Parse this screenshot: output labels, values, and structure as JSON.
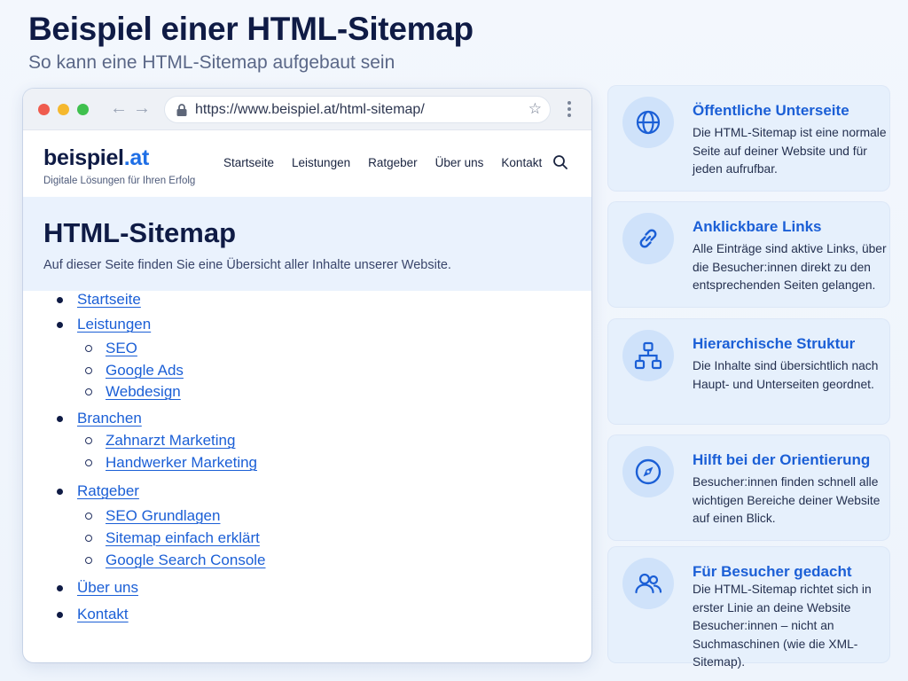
{
  "header": {
    "title": "Beispiel einer HTML-Sitemap",
    "subtitle": "So kann eine HTML-Sitemap aufgebaut sein"
  },
  "browser": {
    "url": "https://www.beispiel.at/html-sitemap/",
    "icons": [
      "back-arrow-icon",
      "forward-arrow-icon",
      "lock-icon",
      "star-icon",
      "kebab-menu-icon"
    ]
  },
  "site": {
    "logo_name": "beispiel",
    "logo_tld": ".at",
    "tagline": "Digitale Lösungen für Ihren Erfolg",
    "nav": [
      "Startseite",
      "Leistungen",
      "Ratgeber",
      "Über uns",
      "Kontakt"
    ],
    "hero_title": "HTML-Sitemap",
    "hero_description": "Auf dieser Seite finden Sie eine Übersicht aller Inhalte unserer Website."
  },
  "sitemap": [
    {
      "label": "Startseite",
      "level": 1
    },
    {
      "label": "Leistungen",
      "level": 1
    },
    {
      "label": "SEO",
      "level": 2
    },
    {
      "label": "Google Ads",
      "level": 2
    },
    {
      "label": "Webdesign",
      "level": 2
    },
    {
      "label": "Branchen",
      "level": 1
    },
    {
      "label": "Zahnarzt Marketing",
      "level": 2
    },
    {
      "label": "Handwerker Marketing",
      "level": 2
    },
    {
      "label": "Ratgeber",
      "level": 1
    },
    {
      "label": "SEO Grundlagen",
      "level": 2
    },
    {
      "label": "Sitemap einfach erklärt",
      "level": 2
    },
    {
      "label": "Google Search Console",
      "level": 2
    },
    {
      "label": "Über uns",
      "level": 1
    },
    {
      "label": "Kontakt",
      "level": 1
    }
  ],
  "cards": [
    {
      "icon": "globe-icon",
      "title": "Öffentliche Unterseite",
      "text": "Die HTML-Sitemap ist eine normale Seite auf deiner Website und für jeden aufrufbar."
    },
    {
      "icon": "link-icon",
      "title": "Anklickbare Links",
      "text": "Alle Einträge sind aktive Links, über die Besucher:innen direkt zu den entsprechenden Seiten gelangen."
    },
    {
      "icon": "hierarchy-icon",
      "title": "Hierarchische Struktur",
      "text": "Die Inhalte sind übersichtlich nach Haupt- und Unterseiten geordnet."
    },
    {
      "icon": "compass-icon",
      "title": "Hilft bei der Orientierung",
      "text": "Besucher:innen finden schnell alle wichtigen Bereiche deiner Website auf einen Blick."
    },
    {
      "icon": "users-icon",
      "title": "Für Besucher gedacht",
      "text": "Die HTML-Sitemap richtet sich in erster Linie an deine Website Besucher:innen – nicht an Suchmaschinen (wie die XML-Sitemap)."
    }
  ],
  "colors": {
    "accent": "#1b5fd6",
    "title": "#0f1b45",
    "card_bg": "#e6f0fc",
    "hero_bg": "#eaf2fd"
  }
}
